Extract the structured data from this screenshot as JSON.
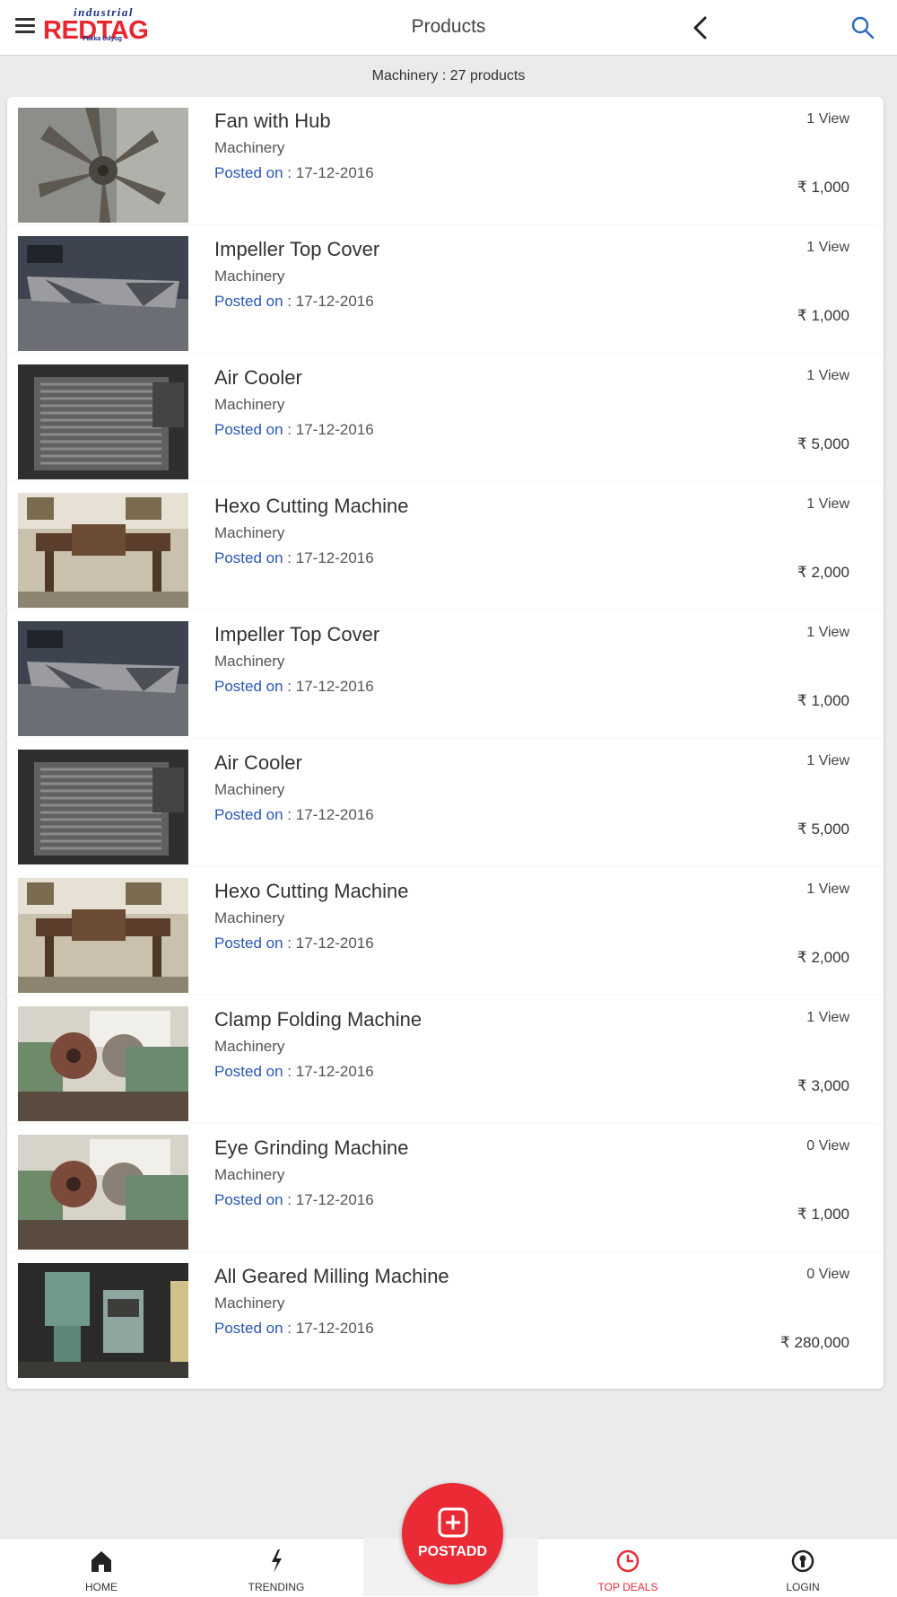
{
  "header": {
    "logo_top": "industrial",
    "logo_main": "REDTAG",
    "logo_tagline": "Pakka Udyog",
    "title": "Products"
  },
  "subheader": {
    "text": "Machinery : 27 products"
  },
  "products": [
    {
      "title": "Fan with Hub",
      "category": "Machinery",
      "date_label": "Posted on :",
      "date": "17-12-2016",
      "views": "1 View",
      "price": "₹ 1,000",
      "image": "fan"
    },
    {
      "title": "Impeller Top Cover",
      "category": "Machinery",
      "date_label": "Posted on :",
      "date": "17-12-2016",
      "views": "1 View",
      "price": "₹ 1,000",
      "image": "impeller"
    },
    {
      "title": "Air Cooler",
      "category": "Machinery",
      "date_label": "Posted on :",
      "date": "17-12-2016",
      "views": "1 View",
      "price": "₹ 5,000",
      "image": "cooler"
    },
    {
      "title": "Hexo Cutting Machine",
      "category": "Machinery",
      "date_label": "Posted on :",
      "date": "17-12-2016",
      "views": "1 View",
      "price": "₹ 2,000",
      "image": "hexo"
    },
    {
      "title": "Impeller Top Cover",
      "category": "Machinery",
      "date_label": "Posted on :",
      "date": "17-12-2016",
      "views": "1 View",
      "price": "₹ 1,000",
      "image": "impeller"
    },
    {
      "title": "Air Cooler",
      "category": "Machinery",
      "date_label": "Posted on :",
      "date": "17-12-2016",
      "views": "1 View",
      "price": "₹ 5,000",
      "image": "cooler"
    },
    {
      "title": "Hexo Cutting Machine",
      "category": "Machinery",
      "date_label": "Posted on :",
      "date": "17-12-2016",
      "views": "1 View",
      "price": "₹ 2,000",
      "image": "hexo"
    },
    {
      "title": "Clamp Folding Machine",
      "category": "Machinery",
      "date_label": "Posted on :",
      "date": "17-12-2016",
      "views": "1 View",
      "price": "₹ 3,000",
      "image": "clamp"
    },
    {
      "title": "Eye Grinding Machine",
      "category": "Machinery",
      "date_label": "Posted on :",
      "date": "17-12-2016",
      "views": "0 View",
      "price": "₹ 1,000",
      "image": "clamp"
    },
    {
      "title": "All Geared Milling Machine",
      "category": "Machinery",
      "date_label": "Posted on :",
      "date": "17-12-2016",
      "views": "0 View",
      "price": "₹ 280,000",
      "image": "milling"
    }
  ],
  "bottom_nav": {
    "items": [
      {
        "label": "HOME",
        "icon": "home-icon"
      },
      {
        "label": "TRENDING",
        "icon": "trending-icon"
      },
      {
        "label": "TOP DEALS",
        "icon": "clock-icon"
      },
      {
        "label": "LOGIN",
        "icon": "login-icon"
      }
    ],
    "fab_label": "POSTADD",
    "accent_color": "#ea2b35"
  }
}
